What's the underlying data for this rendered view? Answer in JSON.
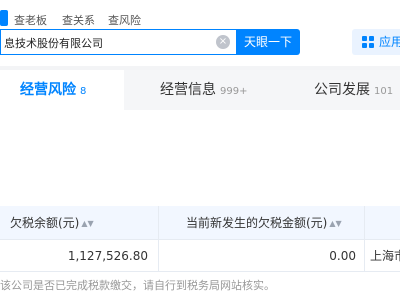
{
  "search": {
    "tabs": [
      "查老板",
      "查关系",
      "查风险"
    ],
    "value": "息技术股份有限公司",
    "button_label": "天眼一下",
    "app_label": "应用"
  },
  "section_tabs": [
    {
      "label": "经营风险",
      "count": "8",
      "active": true
    },
    {
      "label": "经营信息",
      "count": "999+",
      "active": false
    },
    {
      "label": "公司发展",
      "count": "101",
      "active": false
    }
  ],
  "table": {
    "headers": [
      "欠税余额(元)",
      "当前新发生的欠税金额(元)"
    ],
    "row": {
      "tax_balance": "1,127,526.80",
      "new_tax_amount": "0.00",
      "authority": "上海市"
    }
  },
  "note": "该公司是否已完成税款缴交，请自行到税务局网站核实。",
  "colors": {
    "accent": "#0084ff",
    "header_bg": "#f2f7ff",
    "tabbar_bg": "#f5f6f8"
  }
}
